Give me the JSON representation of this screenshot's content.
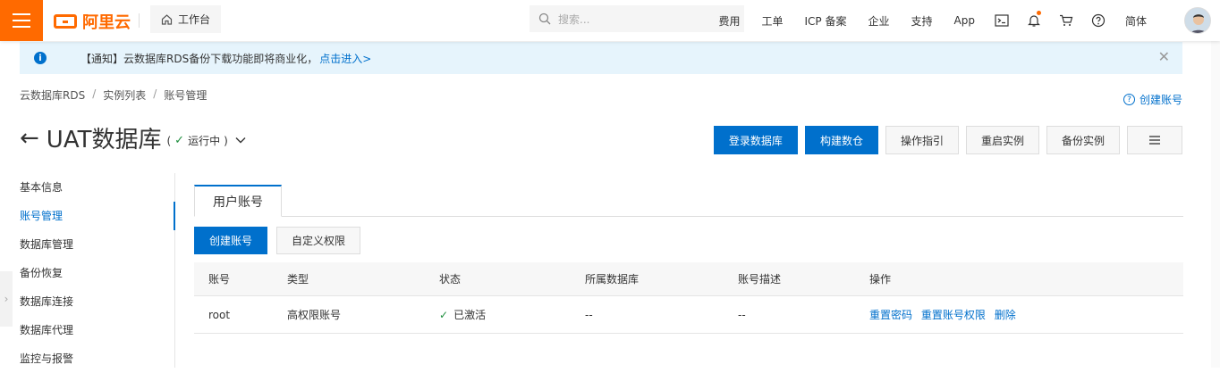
{
  "topbar": {
    "logo_text": "阿里云",
    "workbench": "工作台",
    "search_placeholder": "搜索...",
    "nav": [
      "费用",
      "工单",
      "ICP 备案",
      "企业",
      "支持",
      "App"
    ],
    "lang": "简体",
    "icons": [
      "terminal-icon",
      "bell-icon",
      "cart-icon",
      "help-icon"
    ]
  },
  "notice": {
    "text": "【通知】云数据库RDS备份下载功能即将商业化，",
    "link": "点击进入>"
  },
  "breadcrumb": [
    "云数据库RDS",
    "实例列表",
    "账号管理"
  ],
  "help_link": "创建账号",
  "header": {
    "title": "UAT数据库",
    "status": "运行中",
    "status_open": "(",
    "status_close": ")"
  },
  "actions": [
    "登录数据库",
    "构建数仓",
    "操作指引",
    "重启实例",
    "备份实例"
  ],
  "sidenav": [
    "基本信息",
    "账号管理",
    "数据库管理",
    "备份恢复",
    "数据库连接",
    "数据库代理",
    "监控与报警"
  ],
  "tabs": [
    "用户账号"
  ],
  "toolbar": {
    "create": "创建账号",
    "custom": "自定义权限"
  },
  "table": {
    "headers": [
      "账号",
      "类型",
      "状态",
      "所属数据库",
      "账号描述",
      "操作"
    ],
    "rows": [
      {
        "account": "root",
        "type": "高权限账号",
        "status": "已激活",
        "db": "--",
        "desc": "--",
        "ops": [
          "重置密码",
          "重置账号权限",
          "删除"
        ]
      }
    ]
  },
  "colors": {
    "brand": "#ff6a00",
    "primary": "#0070cc",
    "success": "#1e8e3e",
    "notice_bg": "#e6f4fc"
  }
}
